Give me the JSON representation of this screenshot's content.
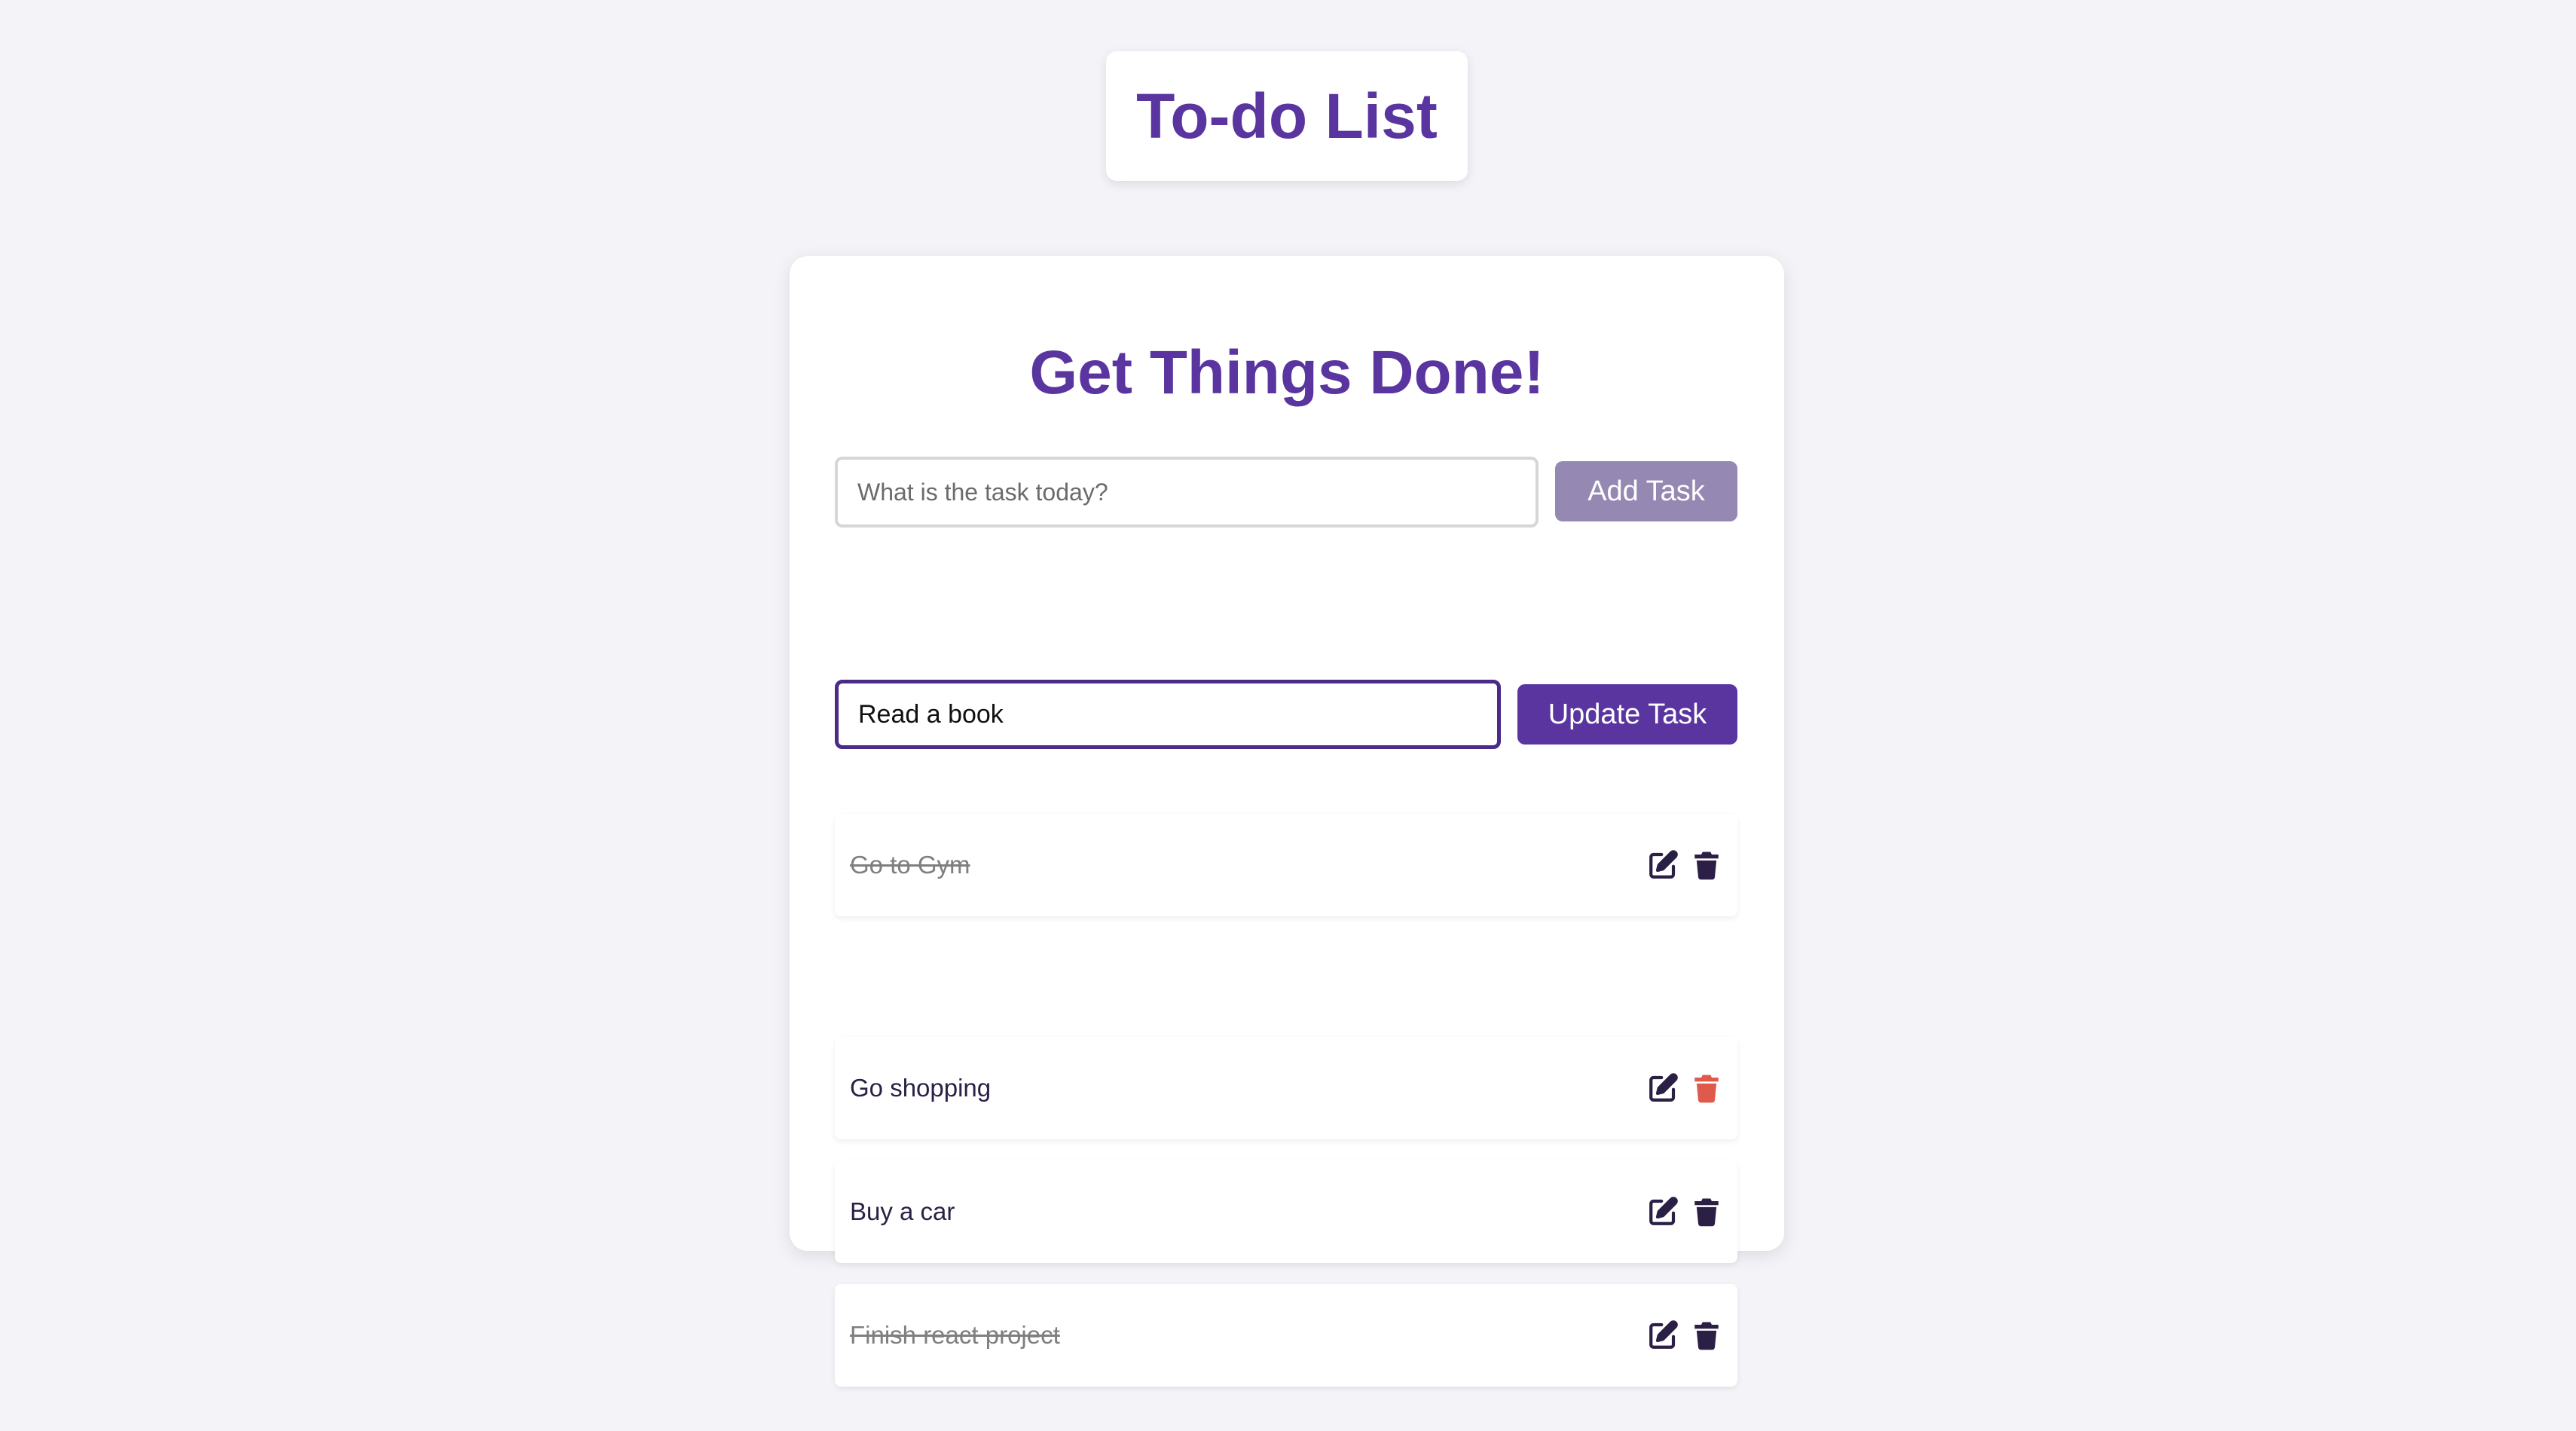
{
  "header": {
    "title": "To-do List"
  },
  "main": {
    "title": "Get Things Done!",
    "new_task": {
      "placeholder": "What is the task today?",
      "value": ""
    },
    "add_button_label": "Add Task",
    "tasks": [
      {
        "text": "Go to Gym",
        "completed": true,
        "editing": false
      },
      {
        "text": "Read a book",
        "completed": false,
        "editing": true
      },
      {
        "text": "Go shopping",
        "completed": false,
        "editing": false,
        "delete_hovered": true
      },
      {
        "text": "Buy a car",
        "completed": false,
        "editing": false
      },
      {
        "text": "Finish react project",
        "completed": true,
        "editing": false
      }
    ],
    "edit_form": {
      "value": "Read a book",
      "button_label": "Update Task"
    }
  },
  "icons": {
    "edit": "edit-icon",
    "delete": "trash-icon"
  },
  "colors": {
    "background": "#f4f3f8",
    "primary": "#5a35a0",
    "add_button": "#9588b3",
    "icon": "#2b1f45",
    "icon_delete_hover": "#e05a4c",
    "completed_text": "#7f7f7f"
  }
}
